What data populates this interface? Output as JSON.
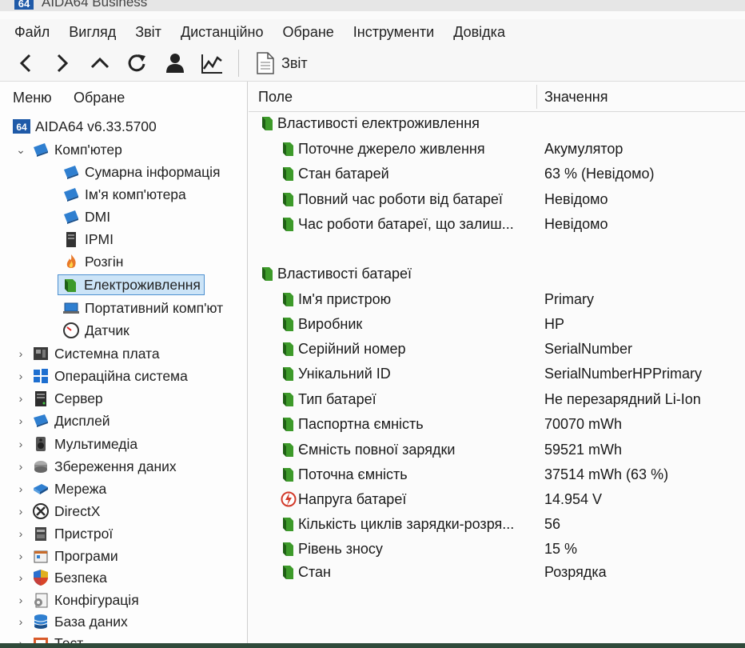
{
  "window": {
    "app_icon_text": "64",
    "title": "AIDA64 Business"
  },
  "menu": [
    "Файл",
    "Вигляд",
    "Звіт",
    "Дистанційно",
    "Обране",
    "Інструменти",
    "Довідка"
  ],
  "toolbar": {
    "report_label": "Звіт"
  },
  "left_tabs": {
    "menu": "Меню",
    "favorites": "Обране"
  },
  "tree": {
    "root": {
      "badge": "64",
      "label": "AIDA64 v6.33.5700"
    },
    "computer": "Комп'ютер",
    "computer_children": [
      "Сумарна інформація",
      "Ім'я комп'ютера",
      "DMI",
      "IPMI",
      "Розгін",
      "Електроживлення",
      "Портативний комп'ют",
      "Датчик"
    ],
    "categories": [
      "Системна плата",
      "Операційна система",
      "Сервер",
      "Дисплей",
      "Мультимедіа",
      "Збереження даних",
      "Мережа",
      "DirectX",
      "Пристрої",
      "Програми",
      "Безпека",
      "Конфігурація",
      "База даних",
      "Тест"
    ]
  },
  "columns": {
    "field": "Поле",
    "value": "Значення"
  },
  "groups": [
    {
      "title": "Властивості електроживлення",
      "rows": [
        {
          "field": "Поточне джерело живлення",
          "value": "Акумулятор"
        },
        {
          "field": "Стан батарей",
          "value": "63 % (Невідомо)"
        },
        {
          "field": "Повний час роботи від батареї",
          "value": "Невідомо"
        },
        {
          "field": "Час роботи батареї, що залиш...",
          "value": "Невідомо"
        }
      ]
    },
    {
      "title": "Властивості батареї",
      "rows": [
        {
          "field": "Ім'я пристрою",
          "value": "Primary"
        },
        {
          "field": "Виробник",
          "value": "HP"
        },
        {
          "field": "Серійний номер",
          "value": "SerialNumber"
        },
        {
          "field": "Унікальний ID",
          "value": "SerialNumberHPPrimary"
        },
        {
          "field": "Тип батареї",
          "value": "Не перезарядний Li-Ion"
        },
        {
          "field": "Паспортна ємність",
          "value": "70070 mWh"
        },
        {
          "field": "Ємність повної зарядки",
          "value": "59521 mWh"
        },
        {
          "field": "Поточна ємність",
          "value": "37514 mWh  (63 %)"
        },
        {
          "field": "Напруга батареї",
          "value": "14.954 V"
        },
        {
          "field": "Кількість циклів зарядки-розря...",
          "value": "56"
        },
        {
          "field": "Рівень зносу",
          "value": "15 %"
        },
        {
          "field": "Стан",
          "value": "Розрядка"
        }
      ]
    }
  ],
  "colors": {
    "selection_bg": "#cce4f7",
    "selection_border": "#4d90d0",
    "battery_green": "#3d9a2a",
    "brand_blue": "#1f5aa8"
  }
}
